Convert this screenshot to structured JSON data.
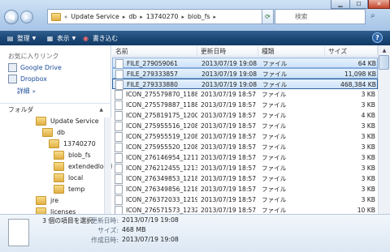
{
  "address": {
    "chevron": "«",
    "crumbs": [
      "Update Service",
      "db",
      "13740270",
      "blob_fs"
    ],
    "search_placeholder": "検索"
  },
  "toolbar": {
    "organize": "整理",
    "views": "表示",
    "burn": "書き込む"
  },
  "nav": {
    "favorites_header": "お気に入りリンク",
    "favorites": [
      "Google Drive",
      "Dropbox"
    ],
    "more": "詳細",
    "folders_header": "フォルダ",
    "tree": [
      {
        "label": "Update Service",
        "depth": 0
      },
      {
        "label": "db",
        "depth": 1
      },
      {
        "label": "13740270",
        "depth": 2
      },
      {
        "label": "blob_fs",
        "depth": 3
      },
      {
        "label": "extendedlocal",
        "depth": 3
      },
      {
        "label": "local",
        "depth": 3
      },
      {
        "label": "temp",
        "depth": 3
      },
      {
        "label": "jre",
        "depth": 0
      },
      {
        "label": "licenses",
        "depth": 0
      },
      {
        "label": "localstorage",
        "depth": 0
      }
    ]
  },
  "columns": {
    "name": "名前",
    "date": "更新日時",
    "type": "種類",
    "size": "サイズ"
  },
  "files": [
    {
      "name": "FILE_279059061",
      "date": "2013/07/19 19:08",
      "type": "ファイル",
      "size": "64 KB"
    },
    {
      "name": "FILE_279333857",
      "date": "2013/07/19 19:08",
      "type": "ファイル",
      "size": "11,098 KB"
    },
    {
      "name": "FILE_279333880",
      "date": "2013/07/19 19:08",
      "type": "ファイル",
      "size": "468,384 KB"
    },
    {
      "name": "ICON_275579870_1188...",
      "date": "2013/07/19 18:57",
      "type": "ファイル",
      "size": "3 KB"
    },
    {
      "name": "ICON_275579887_1188...",
      "date": "2013/07/19 18:57",
      "type": "ファイル",
      "size": "3 KB"
    },
    {
      "name": "ICON_275819175_1200...",
      "date": "2013/07/19 18:57",
      "type": "ファイル",
      "size": "4 KB"
    },
    {
      "name": "ICON_275955516_1208...",
      "date": "2013/07/19 18:57",
      "type": "ファイル",
      "size": "3 KB"
    },
    {
      "name": "ICON_275955519_1208...",
      "date": "2013/07/19 18:57",
      "type": "ファイル",
      "size": "3 KB"
    },
    {
      "name": "ICON_275955520_1208...",
      "date": "2013/07/19 18:57",
      "type": "ファイル",
      "size": "3 KB"
    },
    {
      "name": "ICON_276146954_1211...",
      "date": "2013/07/19 18:57",
      "type": "ファイル",
      "size": "3 KB"
    },
    {
      "name": "ICON_276212455_1213...",
      "date": "2013/07/19 18:57",
      "type": "ファイル",
      "size": "3 KB"
    },
    {
      "name": "ICON_276349853_1218...",
      "date": "2013/07/19 18:57",
      "type": "ファイル",
      "size": "3 KB"
    },
    {
      "name": "ICON_276349856_1218...",
      "date": "2013/07/19 18:57",
      "type": "ファイル",
      "size": "3 KB"
    },
    {
      "name": "ICON_276372033_1219...",
      "date": "2013/07/19 18:57",
      "type": "ファイル",
      "size": "3 KB"
    },
    {
      "name": "ICON_276571573_1232...",
      "date": "2013/07/19 18:57",
      "type": "ファイル",
      "size": "10 KB"
    }
  ],
  "details": {
    "summary": "3 個の項目を選択",
    "modified_label": "更新日時:",
    "modified_value": "2013/07/19 19:08",
    "size_label": "サイズ:",
    "size_value": "468 MB",
    "created_label": "作成日時:",
    "created_value": "2013/07/19 19:08"
  },
  "colors": {
    "toolbar": "#1c4877",
    "selection_border": "#84acdd",
    "link": "#1a4c9a"
  }
}
